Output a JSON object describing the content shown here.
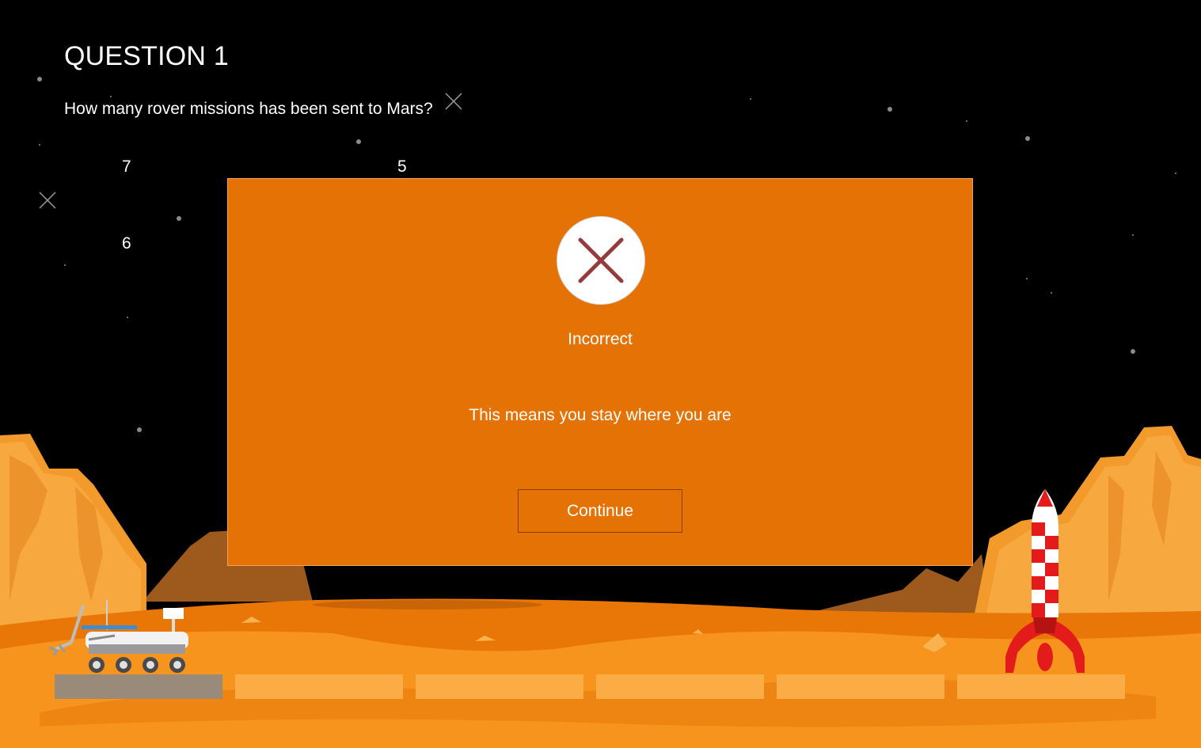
{
  "question": {
    "title": "QUESTION 1",
    "text": "How many rover missions has been sent to Mars?",
    "answers": [
      "7",
      "5",
      "6"
    ]
  },
  "feedback": {
    "icon": "x-mark-icon",
    "status": "Incorrect",
    "message": "This means you stay where you are",
    "continue_label": "Continue"
  },
  "progress": {
    "total_steps": 6,
    "current_step": 1
  },
  "colors": {
    "dialog": "#e57204",
    "ground": "#f7941d",
    "x_mark": "#943c3c"
  }
}
